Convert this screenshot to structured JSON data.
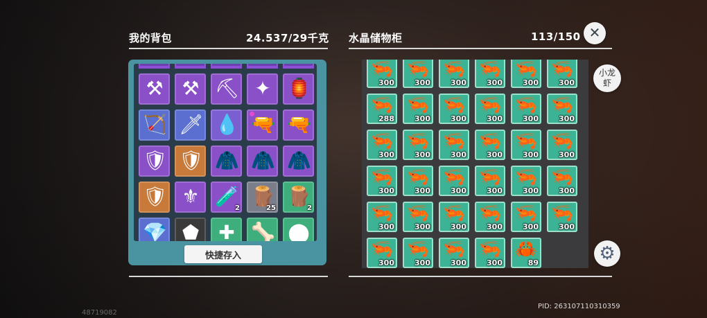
{
  "backpack": {
    "title": "我的背包",
    "weight": "24.537/29千克",
    "quick_store_label": "快捷存入",
    "items": [
      {
        "icon": "✕",
        "bg": "#6b3fb0",
        "count": "",
        "stripe": true
      },
      {
        "icon": "✕",
        "bg": "#6b3fb0",
        "count": "",
        "stripe": true
      },
      {
        "icon": "✕",
        "bg": "#6b3fb0",
        "count": "",
        "stripe": true
      },
      {
        "icon": "✕",
        "bg": "#6b3fb0",
        "count": "",
        "stripe": true
      },
      {
        "icon": "✕",
        "bg": "#6b3fb0",
        "count": "",
        "stripe": true
      },
      {
        "icon": "⚒",
        "bg": "#8a50c8",
        "count": ""
      },
      {
        "icon": "⚒",
        "bg": "#8a50c8",
        "count": ""
      },
      {
        "icon": "⛏",
        "bg": "#8a50c8",
        "count": ""
      },
      {
        "icon": "✦",
        "bg": "#8a50c8",
        "count": ""
      },
      {
        "icon": "🏮",
        "bg": "#8a50c8",
        "count": ""
      },
      {
        "icon": "🏹",
        "bg": "#5a6fd0",
        "count": ""
      },
      {
        "icon": "🗡",
        "bg": "#5a6fd0",
        "count": ""
      },
      {
        "icon": "💧",
        "bg": "#7b5ed0",
        "count": ""
      },
      {
        "icon": "🔫",
        "bg": "#8a50c8",
        "count": "",
        "dot": true
      },
      {
        "icon": "🔫",
        "bg": "#8a50c8",
        "count": ""
      },
      {
        "icon": "🛡",
        "bg": "#8a50c8",
        "count": ""
      },
      {
        "icon": "🛡",
        "bg": "#c87a3a",
        "count": ""
      },
      {
        "icon": "🧥",
        "bg": "#8a50c8",
        "count": ""
      },
      {
        "icon": "🧥",
        "bg": "#8a50c8",
        "count": ""
      },
      {
        "icon": "🧥",
        "bg": "#8a50c8",
        "count": ""
      },
      {
        "icon": "🛡",
        "bg": "#c87a3a",
        "count": ""
      },
      {
        "icon": "⚜",
        "bg": "#8a50c8",
        "count": ""
      },
      {
        "icon": "🧪",
        "bg": "#8a50c8",
        "count": "2"
      },
      {
        "icon": "🪵",
        "bg": "#7a7d8a",
        "count": "25"
      },
      {
        "icon": "🪵",
        "bg": "#3fae7d",
        "count": "2"
      },
      {
        "icon": "💎",
        "bg": "#5a6fd0",
        "count": ""
      },
      {
        "icon": "⬟",
        "bg": "#3a3a3a",
        "count": ""
      },
      {
        "icon": "✚",
        "bg": "#3fae7d",
        "count": ""
      },
      {
        "icon": "🦴",
        "bg": "#3fae7d",
        "count": ""
      },
      {
        "icon": "⬤",
        "bg": "#3fae7d",
        "count": ""
      }
    ]
  },
  "storage": {
    "title": "水晶储物柜",
    "capacity": "113/150",
    "filter_label": "小龙\n虾",
    "items": [
      {
        "icon": "🦐",
        "count": "300"
      },
      {
        "icon": "🦐",
        "count": "300"
      },
      {
        "icon": "🦐",
        "count": "300"
      },
      {
        "icon": "🦐",
        "count": "300"
      },
      {
        "icon": "🦐",
        "count": "300"
      },
      {
        "icon": "🦐",
        "count": "300"
      },
      {
        "icon": "🦐",
        "count": "288"
      },
      {
        "icon": "🦐",
        "count": "300"
      },
      {
        "icon": "🦐",
        "count": "300"
      },
      {
        "icon": "🦐",
        "count": "300"
      },
      {
        "icon": "🦐",
        "count": "300"
      },
      {
        "icon": "🦐",
        "count": "300"
      },
      {
        "icon": "🦐",
        "count": "300"
      },
      {
        "icon": "🦐",
        "count": "300"
      },
      {
        "icon": "🦐",
        "count": "300"
      },
      {
        "icon": "🦐",
        "count": "300"
      },
      {
        "icon": "🦐",
        "count": "300"
      },
      {
        "icon": "🦐",
        "count": "300"
      },
      {
        "icon": "🦐",
        "count": "300"
      },
      {
        "icon": "🦐",
        "count": "300"
      },
      {
        "icon": "🦐",
        "count": "300"
      },
      {
        "icon": "🦐",
        "count": "300"
      },
      {
        "icon": "🦐",
        "count": "300"
      },
      {
        "icon": "🦐",
        "count": "300"
      },
      {
        "icon": "🦐",
        "count": "300"
      },
      {
        "icon": "🦐",
        "count": "300"
      },
      {
        "icon": "🦐",
        "count": "300"
      },
      {
        "icon": "🦐",
        "count": "300"
      },
      {
        "icon": "🦐",
        "count": "300"
      },
      {
        "icon": "🦐",
        "count": "300"
      },
      {
        "icon": "🦐",
        "count": "300"
      },
      {
        "icon": "🦐",
        "count": "300"
      },
      {
        "icon": "🦐",
        "count": "300"
      },
      {
        "icon": "🦐",
        "count": "300"
      },
      {
        "icon": "🦀",
        "count": "89"
      }
    ]
  },
  "buttons": {
    "close_icon": "✕",
    "settings_icon": "⚙"
  },
  "footer": {
    "left_id": "48719082",
    "pid": "PID: 263107110310359"
  }
}
